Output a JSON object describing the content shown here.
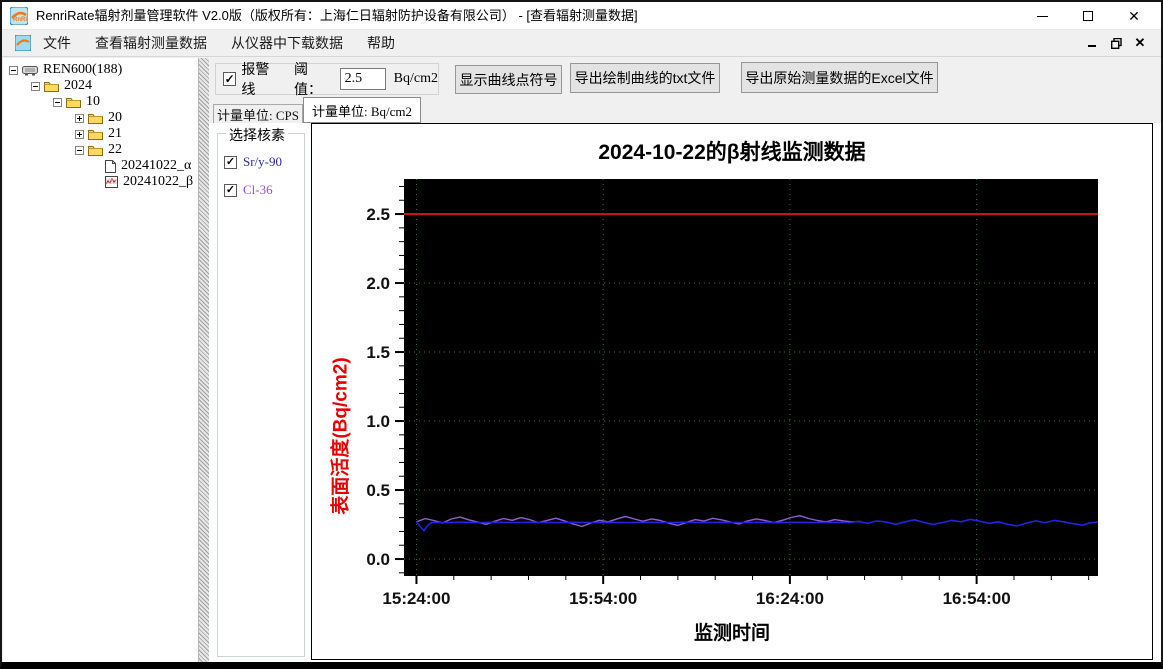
{
  "window": {
    "title": "RenriRate辐射剂量管理软件 V2.0版（版权所有：上海仁日辐射防护设备有限公司） - [查看辐射测量数据]"
  },
  "menu": {
    "items": [
      "文件",
      "查看辐射测量数据",
      "从仪器中下载数据",
      "帮助"
    ]
  },
  "tree": {
    "nodes": [
      {
        "label": "REN600(188)",
        "expander": "-",
        "icon": "device"
      },
      {
        "label": "2024",
        "expander": "-",
        "icon": "folder"
      },
      {
        "label": "10",
        "expander": "-",
        "icon": "folder"
      },
      {
        "label": "20",
        "expander": "+",
        "icon": "folder"
      },
      {
        "label": "21",
        "expander": "+",
        "icon": "folder"
      },
      {
        "label": "22",
        "expander": "-",
        "icon": "folder"
      },
      {
        "label": "20241022_α",
        "expander": "",
        "icon": "document"
      },
      {
        "label": "20241022_β",
        "expander": "",
        "icon": "chart-file"
      }
    ]
  },
  "controls": {
    "alarm_checkbox_label": "报警线",
    "alarm_checked": true,
    "threshold_label": "阈值：",
    "threshold_value": "2.5",
    "threshold_unit": "Bq/cm2",
    "show_points_button": "显示曲线点符号",
    "export_txt_button": "导出绘制曲线的txt文件",
    "export_excel_button": "导出原始测量数据的Excel文件"
  },
  "tabs": [
    {
      "label": "计量单位: CPS",
      "active": false
    },
    {
      "label": "计量单位: Bq/cm2",
      "active": true
    }
  ],
  "nuclide_panel": {
    "title": "选择核素",
    "items": [
      {
        "label": "Sr/y-90",
        "checked": true,
        "color": "#2a2aa0"
      },
      {
        "label": "Cl-36",
        "checked": true,
        "color": "#9a4fd0"
      }
    ]
  },
  "chart_data": {
    "type": "line",
    "title": "2024-10-22的β射线监测数据",
    "xlabel": "监测时间",
    "ylabel": "表面活度(Bq/cm2)",
    "plot_bg": "#000000",
    "grid_color": "#2e7d2e",
    "t_domain": [
      -2,
      109.5
    ],
    "v_domain": [
      -0.123,
      2.754
    ],
    "x_ticks": [
      {
        "t": 0,
        "label": "15:24:00"
      },
      {
        "t": 30,
        "label": "15:54:00"
      },
      {
        "t": 60,
        "label": "16:24:00"
      },
      {
        "t": 90,
        "label": "16:54:00"
      }
    ],
    "x_minor_step": 6,
    "x_minor_range": [
      6,
      108
    ],
    "y_ticks": [
      0.0,
      0.5,
      1.0,
      1.5,
      2.0,
      2.5
    ],
    "y_minor_step": 0.1,
    "y_minor_range": [
      -0.1,
      2.7
    ],
    "alarm_line": {
      "value": 2.5,
      "color": "#cf1212"
    },
    "series": [
      {
        "name": "Sr/y-90",
        "color": "#2222e0",
        "width": 1.6,
        "points": [
          [
            0,
            0.272
          ],
          [
            0.6,
            0.235
          ],
          [
            1.2,
            0.205
          ],
          [
            1.8,
            0.245
          ],
          [
            2.5,
            0.266
          ],
          [
            4,
            0.265
          ],
          [
            7,
            0.267
          ],
          [
            10,
            0.264
          ],
          [
            13,
            0.266
          ],
          [
            16,
            0.265
          ],
          [
            19,
            0.267
          ],
          [
            22,
            0.264
          ],
          [
            25,
            0.266
          ],
          [
            28,
            0.265
          ],
          [
            31,
            0.266
          ],
          [
            34,
            0.264
          ],
          [
            37,
            0.266
          ],
          [
            40,
            0.265
          ],
          [
            43,
            0.267
          ],
          [
            46,
            0.264
          ],
          [
            49,
            0.266
          ],
          [
            52,
            0.265
          ],
          [
            55,
            0.266
          ],
          [
            58,
            0.264
          ],
          [
            61,
            0.266
          ],
          [
            64,
            0.265
          ],
          [
            67,
            0.266
          ],
          [
            69.5,
            0.265
          ],
          [
            71,
            0.272
          ],
          [
            72.5,
            0.258
          ],
          [
            74,
            0.276
          ],
          [
            75.5,
            0.268
          ],
          [
            77,
            0.252
          ],
          [
            78.5,
            0.27
          ],
          [
            80,
            0.284
          ],
          [
            81.5,
            0.266
          ],
          [
            83,
            0.25
          ],
          [
            84.5,
            0.264
          ],
          [
            86,
            0.28
          ],
          [
            87.5,
            0.27
          ],
          [
            89,
            0.288
          ],
          [
            90.5,
            0.274
          ],
          [
            92,
            0.258
          ],
          [
            93.5,
            0.27
          ],
          [
            95,
            0.252
          ],
          [
            96.5,
            0.24
          ],
          [
            98,
            0.26
          ],
          [
            99.5,
            0.276
          ],
          [
            101,
            0.264
          ],
          [
            102.5,
            0.28
          ],
          [
            104,
            0.27
          ],
          [
            105.5,
            0.256
          ],
          [
            107,
            0.246
          ],
          [
            108.2,
            0.262
          ],
          [
            109.5,
            0.268
          ]
        ]
      },
      {
        "name": "Cl-36",
        "color": "#8f5fd0",
        "width": 1.4,
        "points": [
          [
            0,
            0.27
          ],
          [
            1.4,
            0.293
          ],
          [
            2.8,
            0.279
          ],
          [
            4.2,
            0.262
          ],
          [
            5.6,
            0.29
          ],
          [
            7,
            0.304
          ],
          [
            8.4,
            0.284
          ],
          [
            9.8,
            0.268
          ],
          [
            11.2,
            0.251
          ],
          [
            12.6,
            0.274
          ],
          [
            14,
            0.294
          ],
          [
            15.4,
            0.281
          ],
          [
            16.8,
            0.3
          ],
          [
            18.2,
            0.286
          ],
          [
            19.6,
            0.264
          ],
          [
            21,
            0.28
          ],
          [
            22.4,
            0.296
          ],
          [
            23.8,
            0.276
          ],
          [
            25.2,
            0.254
          ],
          [
            26.6,
            0.236
          ],
          [
            28,
            0.26
          ],
          [
            29.4,
            0.281
          ],
          [
            30.8,
            0.27
          ],
          [
            32.2,
            0.291
          ],
          [
            33.6,
            0.309
          ],
          [
            35,
            0.29
          ],
          [
            36.4,
            0.274
          ],
          [
            37.8,
            0.291
          ],
          [
            39.2,
            0.279
          ],
          [
            40.6,
            0.259
          ],
          [
            42,
            0.244
          ],
          [
            43.4,
            0.266
          ],
          [
            44.8,
            0.286
          ],
          [
            46.2,
            0.275
          ],
          [
            47.6,
            0.295
          ],
          [
            49,
            0.284
          ],
          [
            50.4,
            0.269
          ],
          [
            51.8,
            0.254
          ],
          [
            53.2,
            0.276
          ],
          [
            54.6,
            0.291
          ],
          [
            56,
            0.279
          ],
          [
            57.4,
            0.264
          ],
          [
            58.8,
            0.281
          ],
          [
            60.2,
            0.301
          ],
          [
            61.6,
            0.314
          ],
          [
            63,
            0.294
          ],
          [
            64.4,
            0.279
          ],
          [
            65.8,
            0.269
          ],
          [
            67.2,
            0.286
          ],
          [
            68.6,
            0.276
          ],
          [
            70,
            0.27
          ],
          [
            71.4,
            0.272
          ]
        ]
      }
    ]
  }
}
